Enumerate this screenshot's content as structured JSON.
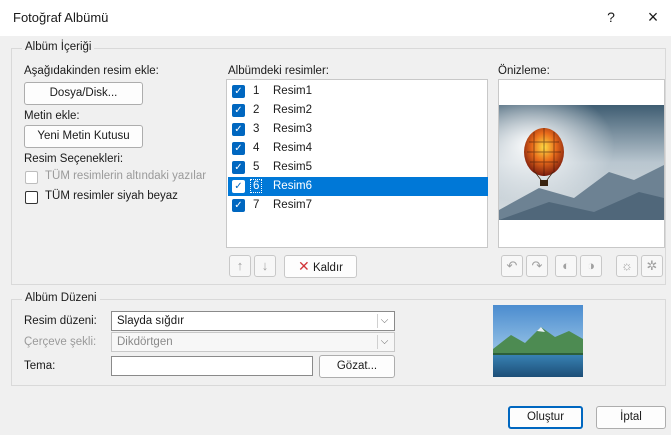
{
  "window": {
    "title": "Fotoğraf Albümü",
    "help": "?",
    "close": "×"
  },
  "content_group": {
    "label": "Albüm İçeriği",
    "insert_from_label": "Aşağıdakinden resim ekle:",
    "file_disk_button": "Dosya/Disk...",
    "insert_text_label": "Metin ekle:",
    "new_textbox_button": "Yeni Metin Kutusu",
    "picture_options_label": "Resim Seçenekleri:",
    "captions_below_label": "TÜM resimlerin altındaki yazılar",
    "black_white_label": "TÜM resimler siyah beyaz",
    "captions_checked": false,
    "black_white_checked": false
  },
  "album_list": {
    "label": "Albümdeki resimler:",
    "items": [
      {
        "num": "1",
        "name": "Resim1",
        "checked": true,
        "selected": false
      },
      {
        "num": "2",
        "name": "Resim2",
        "checked": true,
        "selected": false
      },
      {
        "num": "3",
        "name": "Resim3",
        "checked": true,
        "selected": false
      },
      {
        "num": "4",
        "name": "Resim4",
        "checked": true,
        "selected": false
      },
      {
        "num": "5",
        "name": "Resim5",
        "checked": true,
        "selected": false
      },
      {
        "num": "6",
        "name": "Resim6",
        "checked": true,
        "selected": true
      },
      {
        "num": "7",
        "name": "Resim7",
        "checked": true,
        "selected": false
      }
    ],
    "remove_button": "Kaldır"
  },
  "preview": {
    "label": "Önizleme:"
  },
  "layout_group": {
    "label": "Albüm Düzeni",
    "picture_layout_label": "Resim düzeni:",
    "picture_layout_value": "Slayda sığdır",
    "frame_shape_label": "Çerçeve şekli:",
    "frame_shape_value": "Dikdörtgen",
    "theme_label": "Tema:",
    "theme_value": "",
    "browse_button": "Gözat..."
  },
  "footer": {
    "create_button": "Oluştur",
    "cancel_button": "İptal"
  },
  "colors": {
    "accent": "#0067c0",
    "selection": "#0078d7",
    "dialog_bg": "#f0f0f0"
  }
}
